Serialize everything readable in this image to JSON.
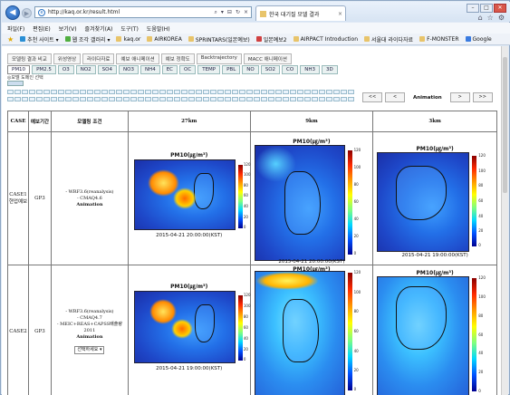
{
  "browser": {
    "url": "http://kaq.or.kr/result.html",
    "tab_title": "한국 대기질 모델 결과",
    "menu": [
      "파일(F)",
      "편집(E)",
      "보기(V)",
      "즐겨찾기(A)",
      "도구(T)",
      "도움말(H)"
    ],
    "favorites": [
      "추천 사이트 ▾",
      "웹 조각 갤러리 ▾",
      "kaq.or",
      "AIRKOREA",
      "SPRINTARS(일본예보)",
      "일본예보2",
      "AIRPACT Introduction",
      "서울대 라이다자료",
      "F-MONSTER",
      "Google"
    ]
  },
  "page": {
    "tabs_top": [
      "모델링 결과 비교",
      "위성영상",
      "라이다자료",
      "예보 애니메이션",
      "예보 정확도",
      "Backtrajectory",
      "MACC 애니메이션"
    ],
    "tabs_species": [
      "PM10",
      "PM2.5",
      "O3",
      "NO2",
      "SO4",
      "NO3",
      "NH4",
      "EC",
      "OC",
      "TEMP",
      "PBL",
      "NO",
      "SO2",
      "CO",
      "NH3",
      "3D"
    ],
    "domain_label": "◎모델 도메인 선택",
    "anim_buttons": [
      "<<",
      "<",
      ">",
      ">>"
    ],
    "anim_label": "Animation"
  },
  "table": {
    "headers": [
      "CASE",
      "예보기간",
      "모델링 조건",
      "27km",
      "9km",
      "3km"
    ],
    "rows": [
      {
        "case": "CASE1\n현업예보",
        "period": "GP3",
        "conditions": [
          "- WRF3.6(reanalysis)",
          "- CMAQ4.6",
          "Animation"
        ],
        "select": "",
        "maps": [
          {
            "title": "PM10(㎍/m³)",
            "time": "2015-04-21 20:00:00(KST)",
            "scale": [
              "120",
              "100",
              "80",
              "60",
              "40",
              "20",
              "0"
            ]
          },
          {
            "title": "PM10(㎍/m³)",
            "time": "2015-04-21 20:00:00(KST)",
            "scale": [
              "120",
              "100",
              "80",
              "60",
              "40",
              "20",
              "0"
            ]
          },
          {
            "title": "PM10(㎍/m³)",
            "time": "2015-04-21 19:00:00(KST)",
            "scale": [
              "120",
              "100",
              "80",
              "60",
              "40",
              "20",
              "0"
            ]
          }
        ]
      },
      {
        "case": "CASE2",
        "period": "GP3",
        "conditions": [
          "- WRF3.6(reanalysis)",
          "- CMAQ4.7",
          "- MEIC+REAS+CAPSS배출량 2011",
          "Animation"
        ],
        "select": "선택하세요 ▾",
        "maps": [
          {
            "title": "PM10(㎍/m³)",
            "time": "2015-04-21 19:00:00(KST)",
            "scale": [
              "120",
              "100",
              "80",
              "60",
              "40",
              "20",
              "0"
            ]
          },
          {
            "title": "PM10(㎍/m³)",
            "time": "",
            "scale": [
              "120",
              "100",
              "80",
              "60",
              "40",
              "20",
              "0"
            ]
          },
          {
            "title": "PM10(㎍/m³)",
            "time": "",
            "scale": [
              "120",
              "100",
              "80",
              "60",
              "40",
              "20",
              "0"
            ]
          }
        ]
      }
    ]
  }
}
